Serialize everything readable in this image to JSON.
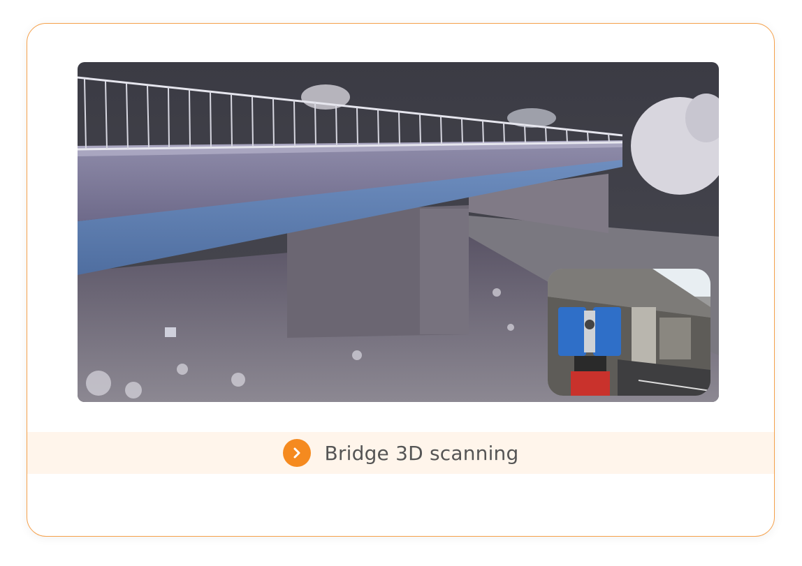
{
  "card": {
    "caption": "Bridge 3D scanning",
    "accent_color": "#f58a1f",
    "border_color": "#f5a04a",
    "caption_bg": "#fff5eb"
  },
  "icons": {
    "caption_icon": "chevron-right-icon"
  },
  "images": {
    "main": "bridge-point-cloud-image",
    "inset": "laser-scanner-under-bridge-photo"
  }
}
